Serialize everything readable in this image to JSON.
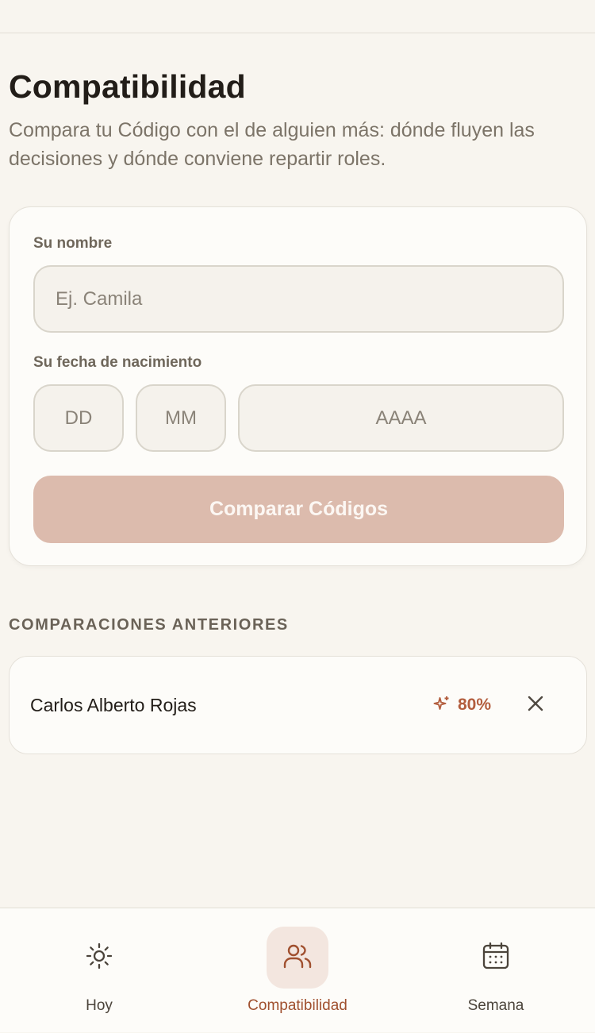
{
  "header": {
    "title": "Compatibilidad",
    "subtitle": "Compara tu Código con el de alguien más: dónde fluyen las decisiones y dónde conviene repartir roles."
  },
  "form": {
    "name_label": "Su nombre",
    "name_value": "",
    "name_placeholder": "Ej. Camila",
    "birthdate_label": "Su fecha de nacimiento",
    "day_value": "",
    "day_placeholder": "DD",
    "month_value": "",
    "month_placeholder": "MM",
    "year_value": "",
    "year_placeholder": "AAAA",
    "submit_label": "Comparar Códigos"
  },
  "history": {
    "heading": "COMPARACIONES ANTERIORES",
    "items": [
      {
        "name": "Carlos Alberto Rojas",
        "score": "80%",
        "icon": "sparkles-icon",
        "action_icon": "close-icon"
      }
    ]
  },
  "nav": {
    "items": [
      {
        "label": "Hoy",
        "icon": "sun-icon",
        "active": false
      },
      {
        "label": "Compatibilidad",
        "icon": "users-icon",
        "active": true
      },
      {
        "label": "Semana",
        "icon": "calendar-icon",
        "active": false
      }
    ]
  },
  "colors": {
    "accent": "#b35e3e",
    "button_disabled": "#dcbbad",
    "background": "#f8f5ef",
    "card": "#fdfcf9",
    "active_nav_bg": "#f3e6df"
  }
}
